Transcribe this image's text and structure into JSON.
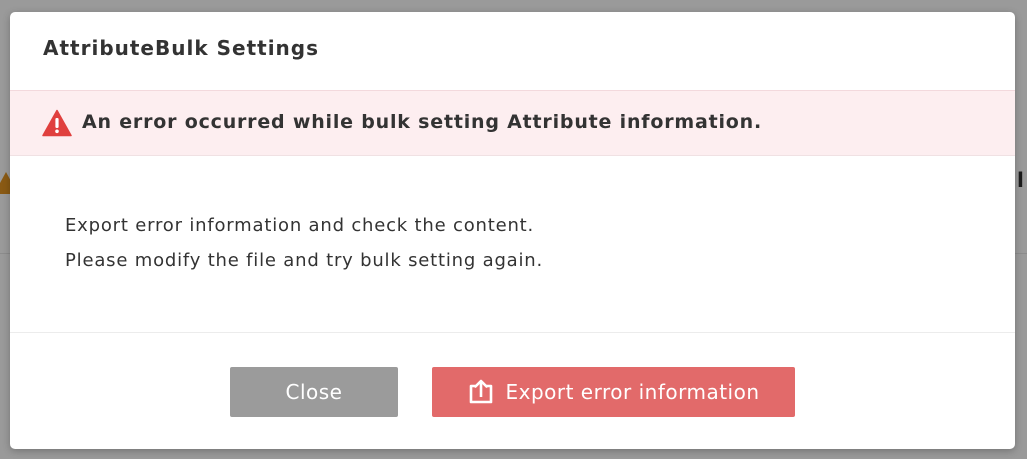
{
  "dialog": {
    "title": "AttributeBulk Settings",
    "error_message": "An error occurred while bulk setting Attribute information.",
    "body_lines": [
      "Export error information and check the content.",
      "Please modify the file and try bulk setting again."
    ],
    "buttons": {
      "close_label": "Close",
      "export_label": "Export error information"
    }
  },
  "colors": {
    "error_banner_bg": "#fdeef0",
    "error_icon": "#e0403e",
    "close_button": "#9b9b9b",
    "export_button": "#e26a6a",
    "backdrop": "#9a9a9a"
  },
  "icons": {
    "error": "warning-triangle-icon",
    "export": "export-upload-icon"
  }
}
